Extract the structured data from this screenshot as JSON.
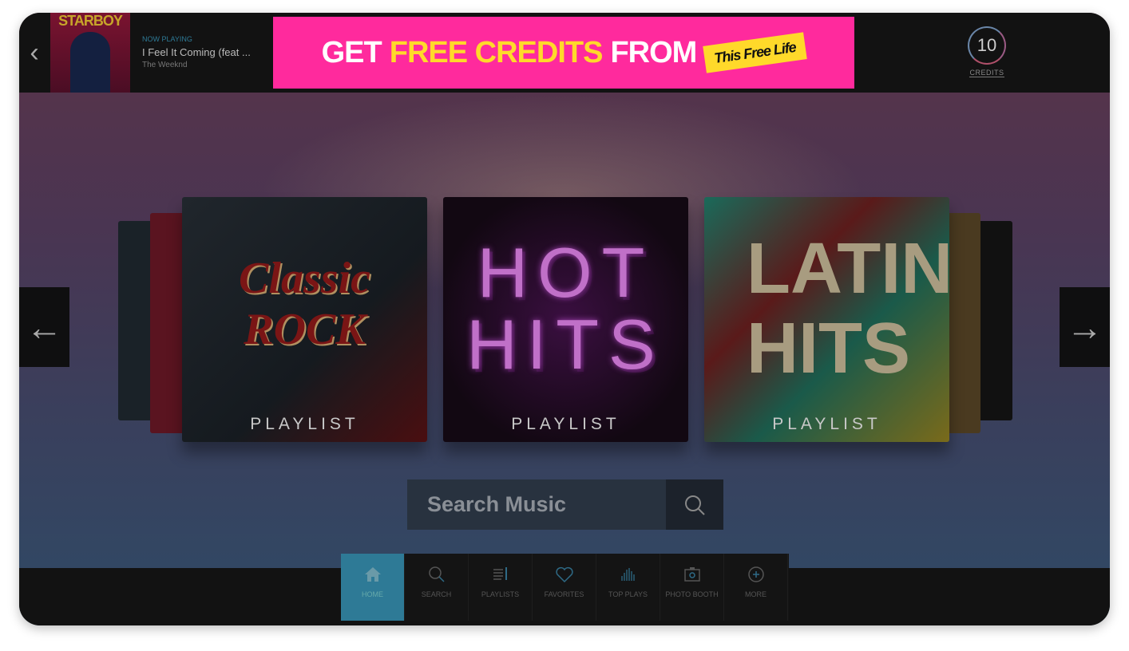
{
  "header": {
    "back_icon": "chevron-left-icon",
    "album_art_text": "STARBOY",
    "now_playing_label": "NOW PLAYING",
    "song_title": "I Feel It Coming (feat ...",
    "artist": "The Weeknd"
  },
  "ad": {
    "part1": "GET",
    "part2": "FREE CREDITS",
    "part3": "FROM",
    "logo_text": "This Free Life",
    "color": "#ff2a9d"
  },
  "credits": {
    "count": "10",
    "label": "CREDITS"
  },
  "carousel": {
    "cards": [
      {
        "title": "Classic ROCK",
        "label": "PLAYLIST"
      },
      {
        "title": "HOT HITS",
        "label": "PLAYLIST"
      },
      {
        "title": "LATIN HITS",
        "label": "PLAYLIST"
      }
    ],
    "prev_icon": "arrow-left-icon",
    "next_icon": "arrow-right-icon"
  },
  "search": {
    "placeholder": "Search Music",
    "icon": "search-icon"
  },
  "nav": {
    "active_color": "#2e7a96",
    "items": [
      {
        "label": "HOME",
        "icon": "home-icon"
      },
      {
        "label": "SEARCH",
        "icon": "search-icon"
      },
      {
        "label": "PLAYLISTS",
        "icon": "playlist-icon"
      },
      {
        "label": "FAVORITES",
        "icon": "heart-icon"
      },
      {
        "label": "TOP PLAYS",
        "icon": "bars-icon"
      },
      {
        "label": "PHOTO BOOTH",
        "icon": "camera-icon"
      },
      {
        "label": "MORE",
        "icon": "plus-circle-icon"
      }
    ]
  }
}
